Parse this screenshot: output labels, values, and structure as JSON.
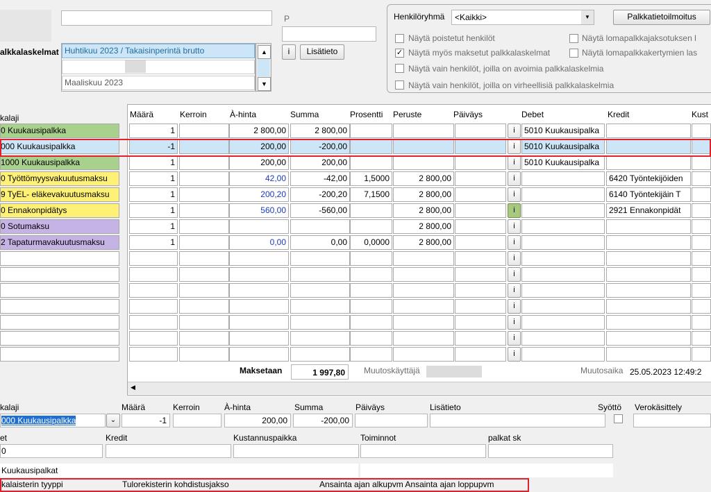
{
  "top": {
    "p_label": "P",
    "calc_label": "alkkalaskelmat",
    "calc_items": [
      "Huhtikuu 2023 / Takaisinperintä brutto",
      "",
      "Maaliskuu 2023"
    ],
    "i_button": "i",
    "lisatieto_button": "Lisätieto"
  },
  "filters": {
    "group_label": "Henkilöryhmä",
    "group_value": "<Kaikki>",
    "report_button": "Palkkatietoilmoitus",
    "options": [
      {
        "label": "Näytä poistetut henkilöt",
        "checked": false
      },
      {
        "label": "Näytä myös maksetut palkkalaskelmat",
        "checked": true
      },
      {
        "label": "Näytä vain henkilöt, joilla on avoimia palkkalaskelmia",
        "checked": false
      },
      {
        "label": "Näytä vain henkilöt, joilla on virheellisiä palkkalaskelmia",
        "checked": false
      },
      {
        "label": "Näytä lomapalkkajaksotuksen l",
        "checked": false
      },
      {
        "label": "Näytä lomapalkkakertymien las",
        "checked": false
      }
    ]
  },
  "grid": {
    "left_header": "kalaji",
    "headers": [
      "Määrä",
      "Kerroin",
      "À-hinta",
      "Summa",
      "Prosentti",
      "Peruste",
      "Päiväys",
      "Debet",
      "Kredit",
      "Kust"
    ],
    "rows": [
      {
        "name": "0 Kuukausipalkka",
        "color": "#a9d18e",
        "maara": "1",
        "kerroin": "",
        "ahinta": "2 800,00",
        "summa": "2 800,00",
        "prosentti": "",
        "peruste": "",
        "paivays": "",
        "debet": "5010 Kuukausipalka",
        "kredit": "",
        "blue": false,
        "green_i": false
      },
      {
        "name": "000 Kuukausipalkka",
        "color": "#cde6f7",
        "maara": "-1",
        "kerroin": "",
        "ahinta": "200,00",
        "summa": "-200,00",
        "prosentti": "",
        "peruste": "",
        "paivays": "",
        "debet": "5010 Kuukausipalka",
        "kredit": "",
        "blue": false,
        "green_i": false
      },
      {
        "name": "1000 Kuukausipalkka",
        "color": "#a9d18e",
        "maara": "1",
        "kerroin": "",
        "ahinta": "200,00",
        "summa": "200,00",
        "prosentti": "",
        "peruste": "",
        "paivays": "",
        "debet": "5010 Kuukausipalka",
        "kredit": "",
        "blue": false,
        "green_i": false
      },
      {
        "name": "0 Työttömyysvakuutusmaksu",
        "color": "#fff176",
        "maara": "1",
        "kerroin": "",
        "ahinta": "42,00",
        "summa": "-42,00",
        "prosentti": "1,5000",
        "peruste": "2 800,00",
        "paivays": "",
        "debet": "",
        "kredit": "6420 Työntekijöiden",
        "blue": true,
        "green_i": false
      },
      {
        "name": "9 TyEL- eläkevakuutusmaksu",
        "color": "#fff176",
        "maara": "1",
        "kerroin": "",
        "ahinta": "200,20",
        "summa": "-200,20",
        "prosentti": "7,1500",
        "peruste": "2 800,00",
        "paivays": "",
        "debet": "",
        "kredit": "6140 Työntekijäin T",
        "blue": true,
        "green_i": false
      },
      {
        "name": "0 Ennakonpidätys",
        "color": "#fff176",
        "maara": "1",
        "kerroin": "",
        "ahinta": "560,00",
        "summa": "-560,00",
        "prosentti": "",
        "peruste": "2 800,00",
        "paivays": "",
        "debet": "",
        "kredit": "2921 Ennakonpidät",
        "blue": true,
        "green_i": true
      },
      {
        "name": "0 Sotumaksu",
        "color": "#c5b3e6",
        "maara": "1",
        "kerroin": "",
        "ahinta": "",
        "summa": "",
        "prosentti": "",
        "peruste": "2 800,00",
        "paivays": "",
        "debet": "",
        "kredit": "",
        "blue": false,
        "green_i": false
      },
      {
        "name": "2 Tapaturmavakuutusmaksu",
        "color": "#c5b3e6",
        "maara": "1",
        "kerroin": "",
        "ahinta": "0,00",
        "summa": "0,00",
        "prosentti": "0,0000",
        "peruste": "2 800,00",
        "paivays": "",
        "debet": "",
        "kredit": "",
        "blue": true,
        "green_i": false
      }
    ],
    "empty_rows": 7,
    "i_label": "i"
  },
  "footer_grid": {
    "maksetaan_label": "Maksetaan",
    "maksetaan_value": "1 997,80",
    "muutoskayttaja_label": "Muutoskäyttäjä",
    "muutosaika_label": "Muutosaika",
    "muutosaika_value": "25.05.2023 12:49:2"
  },
  "editor": {
    "labels": {
      "palkkalaji": "kalaji",
      "maara": "Määrä",
      "kerroin": "Kerroin",
      "ahinta": "À-hinta",
      "summa": "Summa",
      "paivays": "Päiväys",
      "lisatieto": "Lisätieto",
      "syotto": "Syöttö",
      "verokasittely": "Verokäsittely"
    },
    "values": {
      "palkkalaji": "000 Kuukausipalkka",
      "maara": "-1",
      "ahinta": "200,00",
      "summa": "-200,00"
    },
    "labels2": {
      "debet": "et",
      "kredit": "Kredit",
      "kustannuspaikka": "Kustannuspaikka",
      "toiminnot": "Toiminnot",
      "palkat_sk": "palkat sk"
    },
    "debet_value": "0",
    "group_text": "Kuukausipalkat",
    "bottom_texts": [
      "kalaisterin tyyppi",
      "Tulorekisterin kohdistusjakso",
      "Ansainta ajan alkupvm Ansainta ajan loppupvm"
    ]
  }
}
